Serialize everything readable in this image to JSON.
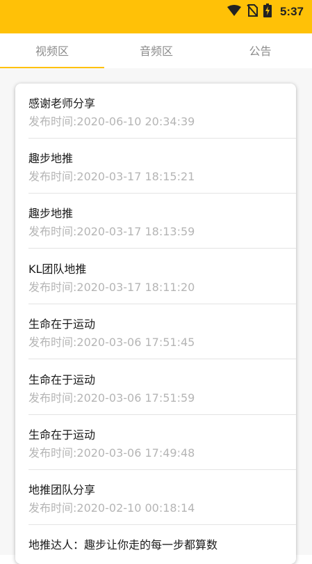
{
  "status_bar": {
    "time": "5:37",
    "icons": [
      "wifi-icon",
      "no-sim-icon",
      "battery-charging-icon"
    ],
    "bg_color": "#FFC107"
  },
  "tabs": [
    {
      "label": "视频区",
      "selected": true
    },
    {
      "label": "音频区",
      "selected": false
    },
    {
      "label": "公告",
      "selected": false
    }
  ],
  "accent_color": "#FFC107",
  "list": [
    {
      "title": "感谢老师分享",
      "time": "发布时间:2020-06-10 20:34:39"
    },
    {
      "title": "趣步地推",
      "time": "发布时间:2020-03-17 18:15:21"
    },
    {
      "title": "趣步地推",
      "time": "发布时间:2020-03-17 18:13:59"
    },
    {
      "title": "KL团队地推",
      "time": "发布时间:2020-03-17 18:11:20"
    },
    {
      "title": "生命在于运动",
      "time": "发布时间:2020-03-06 17:51:45"
    },
    {
      "title": "生命在于运动",
      "time": "发布时间:2020-03-06 17:51:59"
    },
    {
      "title": "生命在于运动",
      "time": "发布时间:2020-03-06 17:49:48"
    },
    {
      "title": "地推团队分享",
      "time": "发布时间:2020-02-10 00:18:14"
    },
    {
      "title": "地推达人：趣步让你走的每一步都算数",
      "time": ""
    }
  ]
}
